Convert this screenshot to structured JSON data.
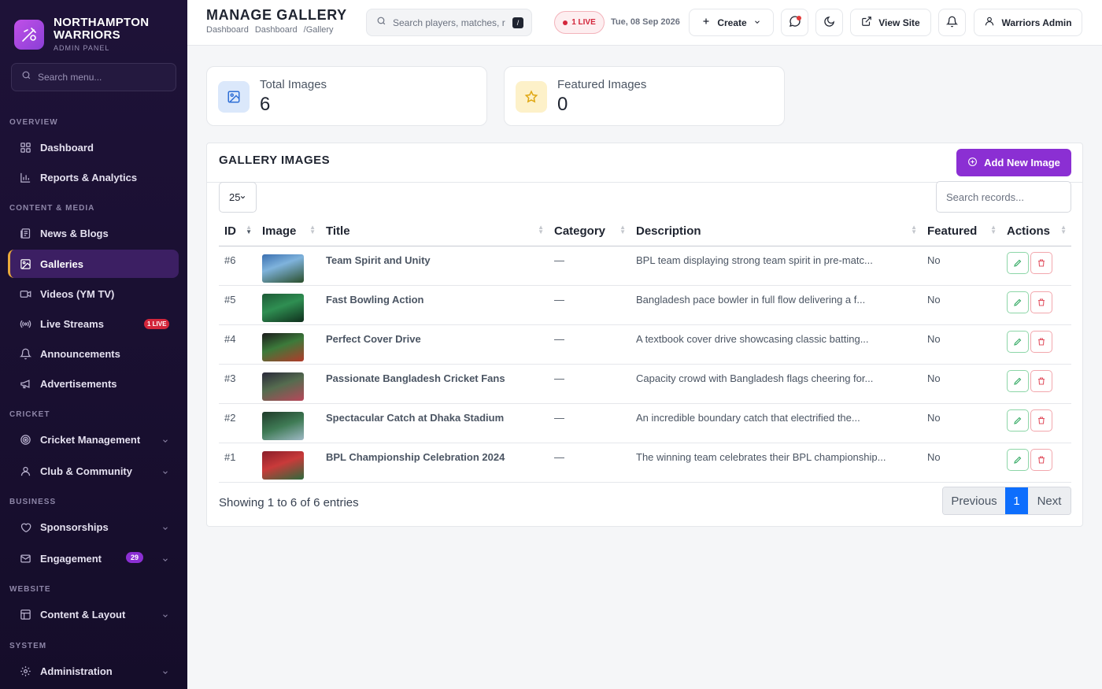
{
  "brand": {
    "name_line1": "NORTHAMPTON",
    "name_line2": "WARRIORS",
    "subtitle": "ADMIN PANEL",
    "accent": "#8b2fd3"
  },
  "sidebar": {
    "search_placeholder": "Search menu...",
    "sections": {
      "overview": "OVERVIEW",
      "content": "CONTENT & MEDIA",
      "cricket": "CRICKET",
      "business": "BUSINESS",
      "website": "WEBSITE",
      "system": "SYSTEM"
    },
    "items": {
      "dashboard": "Dashboard",
      "reports": "Reports & Analytics",
      "news": "News & Blogs",
      "galleries": "Galleries",
      "videos": "Videos (YM TV)",
      "live": "Live Streams",
      "live_badge": "1 LIVE",
      "announcements": "Announcements",
      "advertisements": "Advertisements",
      "cricket_mgmt": "Cricket Management",
      "club": "Club & Community",
      "sponsorships": "Sponsorships",
      "engagement": "Engagement",
      "engagement_badge": "29",
      "content_layout": "Content & Layout",
      "administration": "Administration"
    },
    "active_item": "Galleries"
  },
  "header": {
    "title": "MANAGE GALLERY",
    "breadcrumb": [
      "Dashboard",
      "Dashboard",
      "/Gallery"
    ],
    "search_placeholder": "Search players, matches, r",
    "shortcut": "/",
    "live_label": "1 LIVE",
    "date": "Tue, 08 Sep 2026",
    "create_label": "Create",
    "view_site_label": "View Site",
    "user_label": "Warriors Admin"
  },
  "stats": {
    "total_label": "Total Images",
    "total_value": "6",
    "featured_label": "Featured Images",
    "featured_value": "0"
  },
  "gallery": {
    "title": "GALLERY IMAGES",
    "add_button": "Add New Image",
    "page_length": "25",
    "search_placeholder": "Search records...",
    "columns": [
      "ID",
      "Image",
      "Title",
      "Category",
      "Description",
      "Featured",
      "Actions"
    ],
    "rows": [
      {
        "id": "#6",
        "title": "Team Spirit and Unity",
        "category": "—",
        "description": "BPL team displaying strong team spirit in pre-matc...",
        "featured": "No"
      },
      {
        "id": "#5",
        "title": "Fast Bowling Action",
        "category": "—",
        "description": "Bangladesh pace bowler in full flow delivering a f...",
        "featured": "No"
      },
      {
        "id": "#4",
        "title": "Perfect Cover Drive",
        "category": "—",
        "description": "A textbook cover drive showcasing classic batting...",
        "featured": "No"
      },
      {
        "id": "#3",
        "title": "Passionate Bangladesh Cricket Fans",
        "category": "—",
        "description": "Capacity crowd with Bangladesh flags cheering for...",
        "featured": "No"
      },
      {
        "id": "#2",
        "title": "Spectacular Catch at Dhaka Stadium",
        "category": "—",
        "description": "An incredible boundary catch that electrified the...",
        "featured": "No"
      },
      {
        "id": "#1",
        "title": "BPL Championship Celebration 2024",
        "category": "—",
        "description": "The winning team celebrates their BPL championship...",
        "featured": "No"
      }
    ],
    "showing": "Showing 1 to 6 of 6 entries",
    "pager": {
      "previous": "Previous",
      "current": "1",
      "next": "Next"
    }
  }
}
